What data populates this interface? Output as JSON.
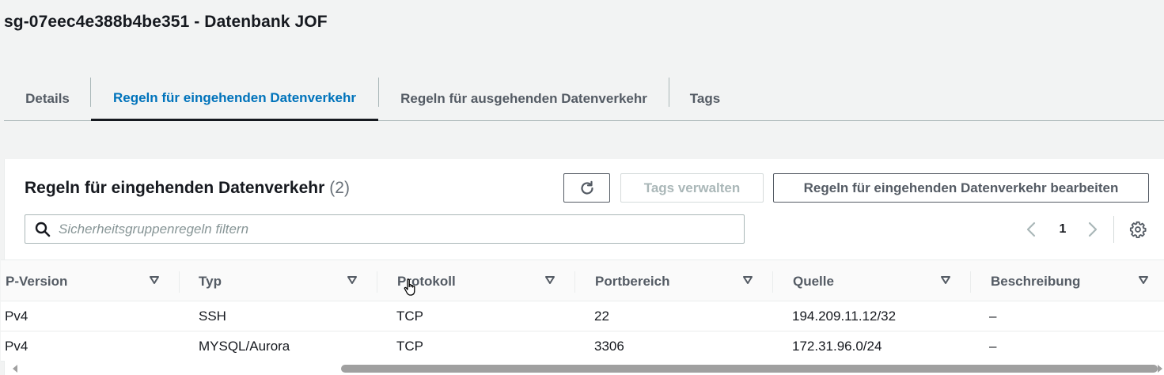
{
  "page": {
    "title": "sg-07eec4e388b4be351 - Datenbank JOF"
  },
  "tabs": [
    {
      "label": "Details"
    },
    {
      "label": "Regeln für eingehenden Datenverkehr"
    },
    {
      "label": "Regeln für ausgehenden Datenverkehr"
    },
    {
      "label": "Tags"
    }
  ],
  "panel": {
    "title": "Regeln für eingehenden Datenverkehr",
    "count": "(2)",
    "buttons": {
      "manage_tags": "Tags verwalten",
      "edit_rules": "Regeln für eingehenden Datenverkehr bearbeiten"
    },
    "search": {
      "placeholder": "Sicherheitsgruppenregeln filtern",
      "value": ""
    },
    "pagination": {
      "current_page": "1"
    }
  },
  "table": {
    "columns": [
      "P-Version",
      "Typ",
      "Protokoll",
      "Portbereich",
      "Quelle",
      "Beschreibung"
    ],
    "rows": [
      [
        "Pv4",
        "SSH",
        "TCP",
        "22",
        "194.209.11.12/32",
        "–"
      ],
      [
        "Pv4",
        "MYSQL/Aurora",
        "TCP",
        "3306",
        "172.31.96.0/24",
        "–"
      ]
    ]
  },
  "icons": {
    "refresh": "refresh-icon",
    "search": "search-icon",
    "prev": "chevron-left-icon",
    "next": "chevron-right-icon",
    "settings": "gear-icon",
    "sort": "sort-caret-down-icon",
    "cursor": "hand-pointer-cursor"
  },
  "colors": {
    "active_tab": "#0073bb",
    "text": "#16191f",
    "muted": "#545b64",
    "disabled": "#aab7b8",
    "background": "#f2f3f3"
  }
}
